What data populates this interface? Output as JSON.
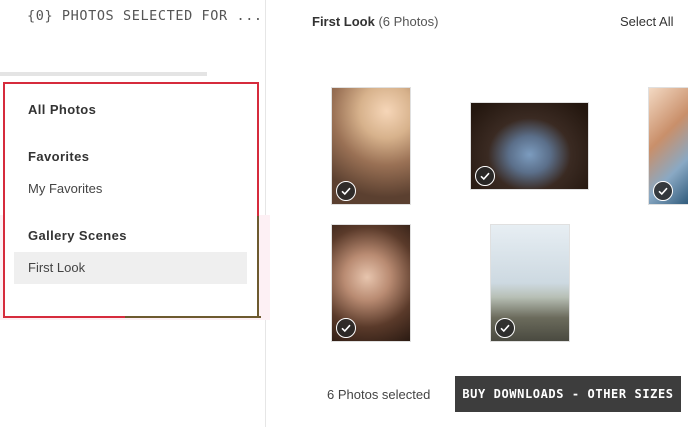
{
  "selection": {
    "title": "{0} PHOTOS SELECTED FOR ..."
  },
  "sidebar": {
    "all_photos": "All Photos",
    "favorites_heading": "Favorites",
    "my_favorites": "My Favorites",
    "scenes_heading": "Gallery Scenes",
    "first_look": "First Look"
  },
  "header": {
    "scene_title": "First Look",
    "photo_count": "(6 Photos)",
    "select_all": "Select All"
  },
  "photos": [
    {
      "icon": "check-icon",
      "selected": true
    },
    {
      "icon": "check-icon",
      "selected": true
    },
    {
      "icon": "check-icon",
      "selected": true
    },
    {
      "icon": "check-icon",
      "selected": true
    },
    {
      "icon": "check-icon",
      "selected": true
    }
  ],
  "footer": {
    "selected_text": "6 Photos selected",
    "buy_label": "BUY DOWNLOADS - OTHER SIZES"
  },
  "colors": {
    "highlight_border": "#d62b3c",
    "button_bg": "#3d3d3d",
    "active_item_bg": "#efefef"
  }
}
